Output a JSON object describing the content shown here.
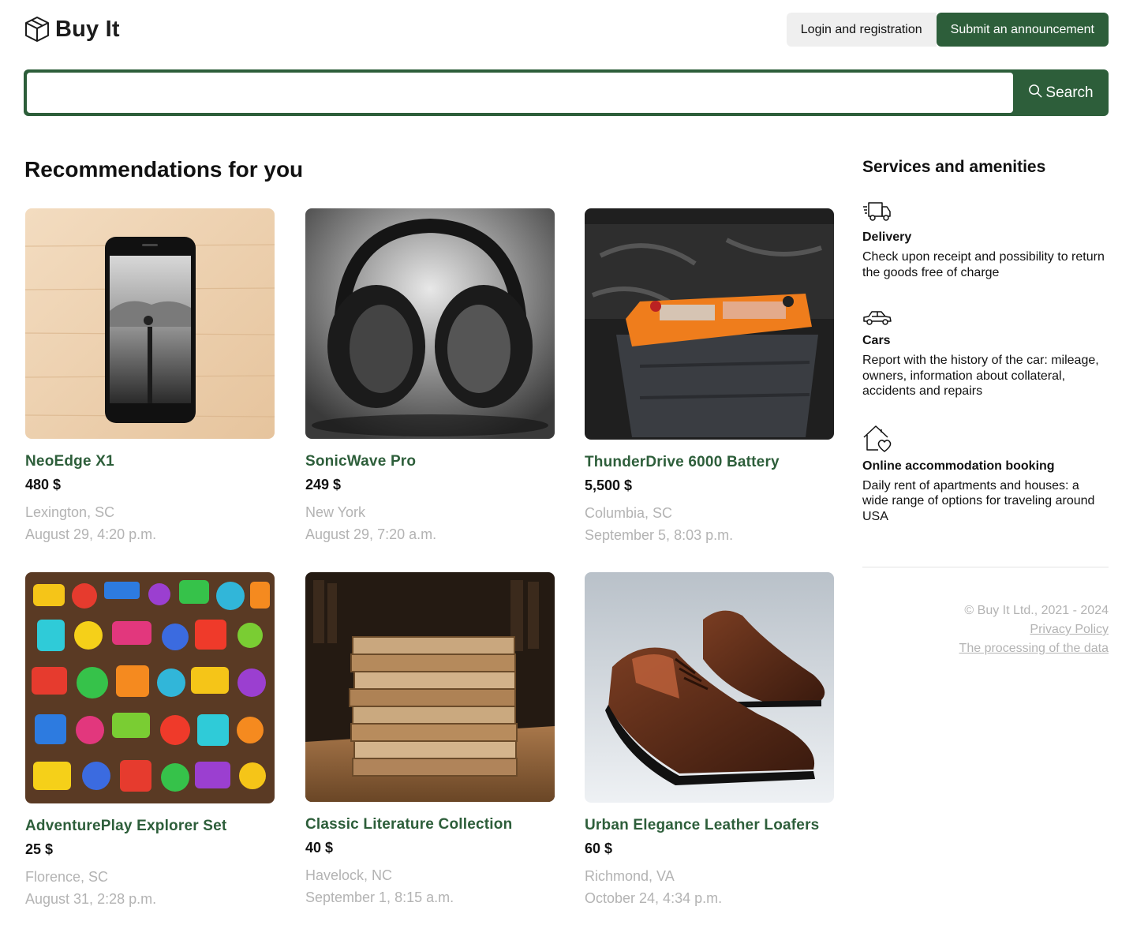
{
  "brand": {
    "name": "Buy It",
    "icon": "box-icon"
  },
  "header": {
    "login_label": "Login and registration",
    "submit_label": "Submit an announcement"
  },
  "search": {
    "value": "",
    "placeholder": "",
    "button_label": "Search",
    "icon": "search-icon"
  },
  "colors": {
    "accent": "#2d5e3a",
    "muted": "#b3b3b3",
    "light_button": "#efefef"
  },
  "recommendations": {
    "title": "Recommendations for you",
    "items": [
      {
        "name": "NeoEdge X1",
        "price": "480 $",
        "location": "Lexington, SC",
        "date": "August 29, 4:20 p.m.",
        "image": "smartphone-photo"
      },
      {
        "name": "SonicWave Pro",
        "price": "249 $",
        "location": "New York",
        "date": "August 29, 7:20 a.m.",
        "image": "headphones-photo"
      },
      {
        "name": "ThunderDrive 6000 Battery",
        "price": "5,500 $",
        "location": "Columbia, SC",
        "date": "September 5, 8:03 p.m.",
        "image": "car-battery-photo"
      },
      {
        "name": "AdventurePlay Explorer Set",
        "price": "25 $",
        "location": "Florence, SC",
        "date": "August 31, 2:28 p.m.",
        "image": "toys-photo"
      },
      {
        "name": "Classic Literature Collection",
        "price": "40 $",
        "location": "Havelock, NC",
        "date": "September 1, 8:15 a.m.",
        "image": "books-photo"
      },
      {
        "name": "Urban Elegance Leather Loafers",
        "price": "60 $",
        "location": "Richmond, VA",
        "date": "October 24, 4:34 p.m.",
        "image": "leather-shoes-photo"
      }
    ]
  },
  "services": {
    "title": "Services and amenities",
    "items": [
      {
        "icon": "delivery-truck-icon",
        "name": "Delivery",
        "description": "Check upon receipt and possibility to return the goods free of charge"
      },
      {
        "icon": "car-icon",
        "name": "Cars",
        "description": "Report with the history of the car: mileage, owners, information about collateral, accidents and repairs"
      },
      {
        "icon": "house-heart-icon",
        "name": "Online accommodation booking",
        "description": "Daily rent of apartments and houses: a wide range of options for traveling around USA"
      }
    ]
  },
  "footer": {
    "copyright": "© Buy It Ltd., 2021 - 2024",
    "privacy_link": "Privacy Policy",
    "data_link": "The processing of the data"
  }
}
